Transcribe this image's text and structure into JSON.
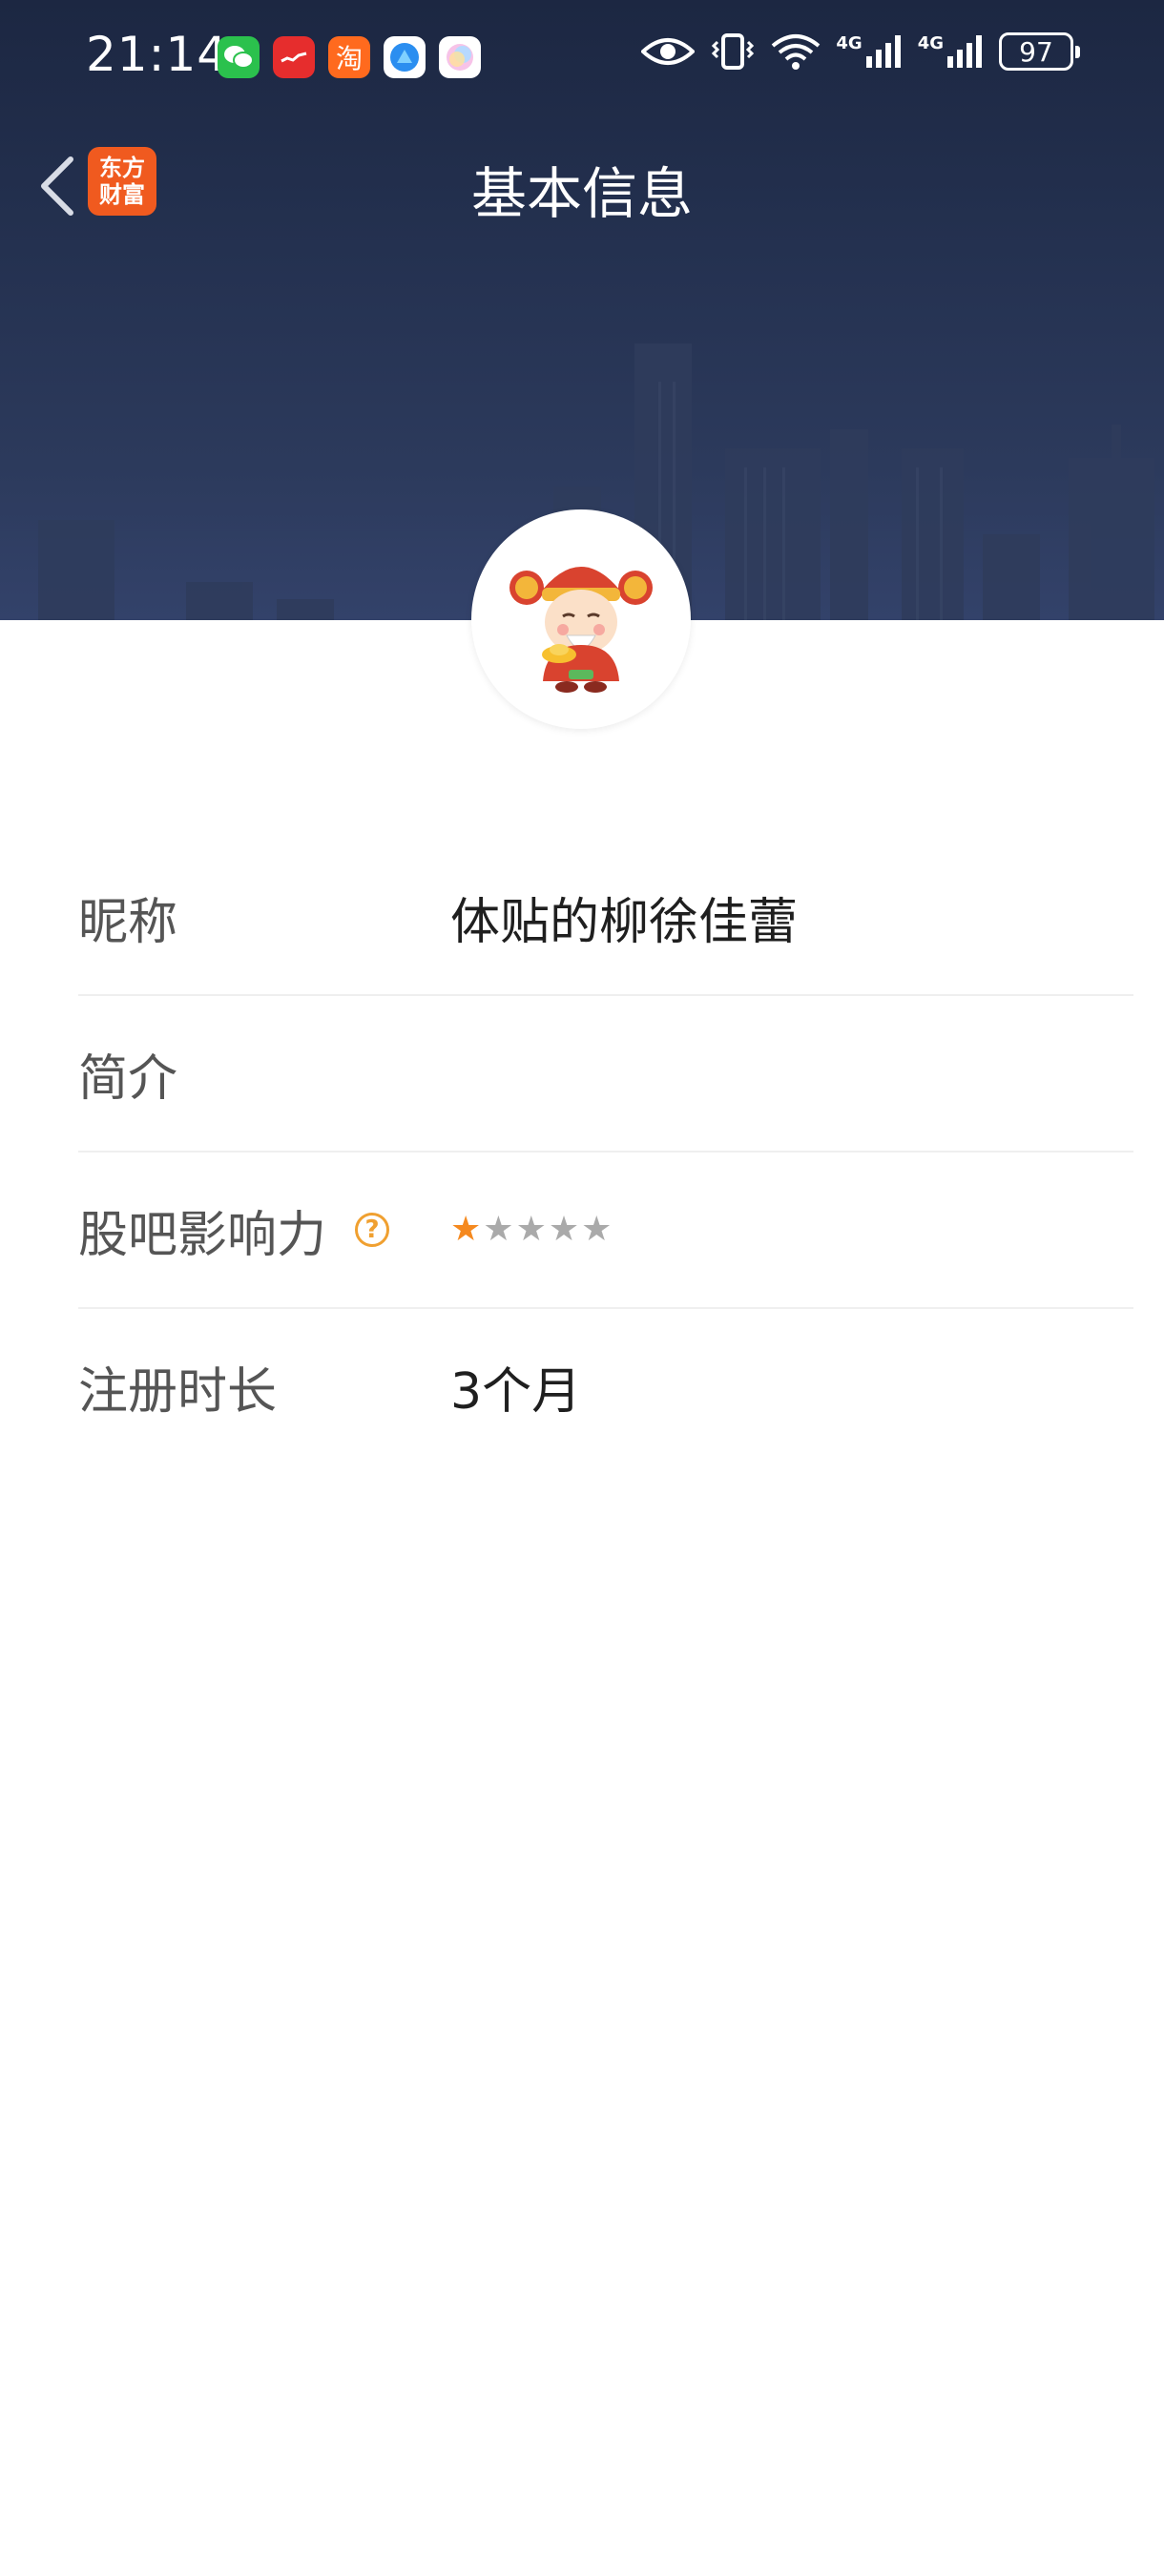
{
  "status_bar": {
    "time": "21:14",
    "battery": "97",
    "network_1": "4G",
    "network_2": "4G"
  },
  "app_icons": [
    "wechat-icon",
    "app-red-icon",
    "taobao-icon",
    "browser-icon",
    "gallery-icon"
  ],
  "taobao_char": "淘",
  "nav": {
    "title": "基本信息",
    "brand_line1": "东方",
    "brand_line2": "财富"
  },
  "profile": {
    "fields": [
      {
        "label": "昵称",
        "value": "体贴的柳徐佳蕾"
      },
      {
        "label": "简介",
        "value": ""
      },
      {
        "label": "股吧影响力",
        "value": "",
        "rating": 1,
        "rating_max": 5
      },
      {
        "label": "注册时长",
        "value": "3个月"
      }
    ],
    "help_symbol": "?"
  },
  "colors": {
    "header_bg": "#1c2742",
    "brand_orange": "#f05a1f",
    "star_active": "#f5891f",
    "star_inactive": "#aaaaaa",
    "help_icon": "#f0a030"
  }
}
